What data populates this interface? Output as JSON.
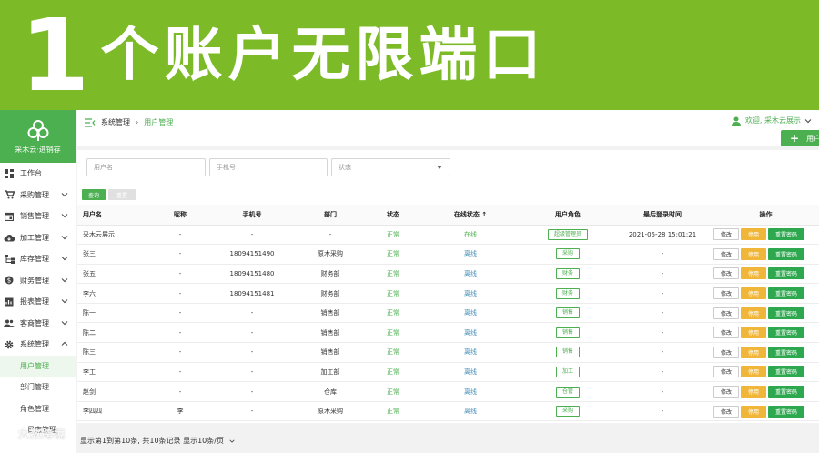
{
  "banner": {
    "number": "1",
    "text": "个账户无限端口"
  },
  "brand": {
    "name": "采木云·进销存"
  },
  "sidebar": {
    "items": [
      {
        "label": "工作台",
        "icon": "dashboard-icon",
        "has_arrow": false
      },
      {
        "label": "采购管理",
        "icon": "cart-icon",
        "has_arrow": true
      },
      {
        "label": "销售管理",
        "icon": "calendar-icon",
        "has_arrow": true
      },
      {
        "label": "加工管理",
        "icon": "cloud-download-icon",
        "has_arrow": true
      },
      {
        "label": "库存管理",
        "icon": "sitemap-icon",
        "has_arrow": true
      },
      {
        "label": "财务管理",
        "icon": "dollar-icon",
        "has_arrow": true
      },
      {
        "label": "报表管理",
        "icon": "report-icon",
        "has_arrow": true
      },
      {
        "label": "客商管理",
        "icon": "people-icon",
        "has_arrow": true
      },
      {
        "label": "系统管理",
        "icon": "gear-icon",
        "has_arrow": true,
        "expanded": true
      }
    ],
    "subitems": [
      {
        "label": "用户管理",
        "active": true
      },
      {
        "label": "部门管理",
        "active": false
      },
      {
        "label": "角色管理",
        "active": false
      }
    ],
    "bottom_text": "日志管理"
  },
  "topbar": {
    "crumbs": [
      "系统管理",
      "用户管理"
    ],
    "user_greeting": "欢迎, 采木云展示",
    "add_label": "用户"
  },
  "search": {
    "username_placeholder": "用户名",
    "phone_placeholder": "手机号",
    "status_placeholder": "状态",
    "query_label": "查询",
    "reset_label": "重置"
  },
  "table": {
    "headers": [
      "用户名",
      "昵称",
      "手机号",
      "部门",
      "状态",
      "在线状态 ↑",
      "用户角色",
      "最后登录时间",
      "操作"
    ],
    "rows": [
      {
        "username": "采木云展示",
        "nickname": "-",
        "phone": "-",
        "dept": "-",
        "status": "正常",
        "online": "在线",
        "role": "超级管理员",
        "last_login": "2021-05-28 15:01:21"
      },
      {
        "username": "张三",
        "nickname": "-",
        "phone": "18094151490",
        "dept": "原木采购",
        "status": "正常",
        "online": "离线",
        "role": "采购",
        "last_login": "-"
      },
      {
        "username": "张五",
        "nickname": "-",
        "phone": "18094151480",
        "dept": "财务部",
        "status": "正常",
        "online": "离线",
        "role": "财务",
        "last_login": "-"
      },
      {
        "username": "李六",
        "nickname": "-",
        "phone": "18094151481",
        "dept": "财务部",
        "status": "正常",
        "online": "离线",
        "role": "财务",
        "last_login": "-"
      },
      {
        "username": "陈一",
        "nickname": "-",
        "phone": "-",
        "dept": "销售部",
        "status": "正常",
        "online": "离线",
        "role": "销售",
        "last_login": "-"
      },
      {
        "username": "陈二",
        "nickname": "-",
        "phone": "-",
        "dept": "销售部",
        "status": "正常",
        "online": "离线",
        "role": "销售",
        "last_login": "-"
      },
      {
        "username": "陈三",
        "nickname": "-",
        "phone": "-",
        "dept": "销售部",
        "status": "正常",
        "online": "离线",
        "role": "销售",
        "last_login": "-"
      },
      {
        "username": "李工",
        "nickname": "-",
        "phone": "-",
        "dept": "加工部",
        "status": "正常",
        "online": "离线",
        "role": "加工",
        "last_login": "-"
      },
      {
        "username": "赵剑",
        "nickname": "-",
        "phone": "-",
        "dept": "仓库",
        "status": "正常",
        "online": "离线",
        "role": "仓管",
        "last_login": "-"
      },
      {
        "username": "李四四",
        "nickname": "李",
        "phone": "-",
        "dept": "原木采购",
        "status": "正常",
        "online": "离线",
        "role": "采购",
        "last_login": "-"
      }
    ],
    "ops": {
      "edit": "修改",
      "stop": "停用",
      "reset": "重置密码"
    }
  },
  "pager": {
    "text": "显示第1到第10条, 共10条记录 显示10条/页"
  },
  "watermark": {
    "text": "大数跨境"
  },
  "colors": {
    "banner": "#7cbb27",
    "brand": "#4caf50",
    "primary": "#4caf50",
    "warning": "#f0b63a",
    "danger_green": "#2ea84f"
  }
}
